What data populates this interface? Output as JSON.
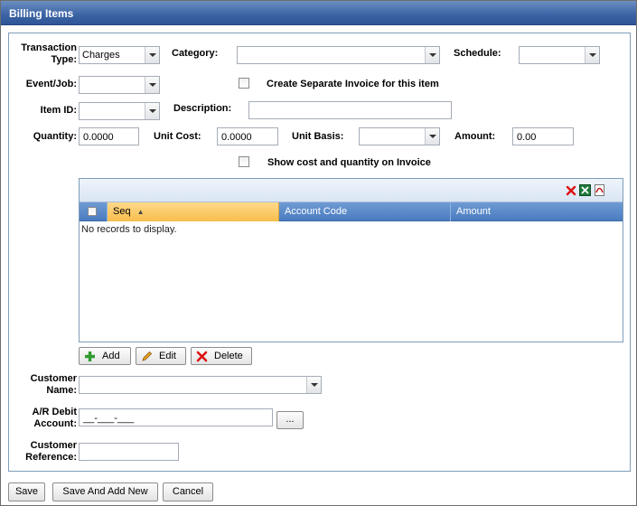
{
  "window": {
    "title": "Billing Items"
  },
  "form": {
    "transaction_type": {
      "label": "Transaction Type:",
      "value": "Charges"
    },
    "category": {
      "label": "Category:",
      "value": ""
    },
    "schedule": {
      "label": "Schedule:",
      "value": ""
    },
    "event_job": {
      "label": "Event/Job:",
      "value": ""
    },
    "separate_invoice": {
      "label": "Create Separate Invoice for this item",
      "checked": false
    },
    "item_id": {
      "label": "Item ID:",
      "value": ""
    },
    "description": {
      "label": "Description:",
      "value": ""
    },
    "quantity": {
      "label": "Quantity:",
      "value": "0.0000"
    },
    "unit_cost": {
      "label": "Unit Cost:",
      "value": "0.0000"
    },
    "unit_basis": {
      "label": "Unit Basis:",
      "value": ""
    },
    "amount": {
      "label": "Amount:",
      "value": "0.00"
    },
    "show_cost": {
      "label": "Show cost and quantity on Invoice",
      "checked": false
    }
  },
  "grid": {
    "columns": [
      "Seq",
      "Account Code",
      "Amount"
    ],
    "sorted_column": "Seq",
    "empty_text": "No records to display.",
    "toolbar_icons": [
      "delete-x-icon",
      "export-excel-icon",
      "export-pdf-icon"
    ]
  },
  "grid_buttons": {
    "add": "Add",
    "edit": "Edit",
    "delete": "Delete"
  },
  "customer": {
    "name_label": "Customer Name:",
    "name_value": "",
    "ar_label": "A/R Debit Account:",
    "ar_value": "__-___-___",
    "ar_browse": "...",
    "ref_label": "Customer Reference:",
    "ref_value": ""
  },
  "footer": {
    "save": "Save",
    "save_add_new": "Save And Add New",
    "cancel": "Cancel"
  },
  "colors": {
    "titlebar": "#3e66a6",
    "grid_header": "#4a7cc0",
    "sorted_header": "#f8bd4c"
  }
}
